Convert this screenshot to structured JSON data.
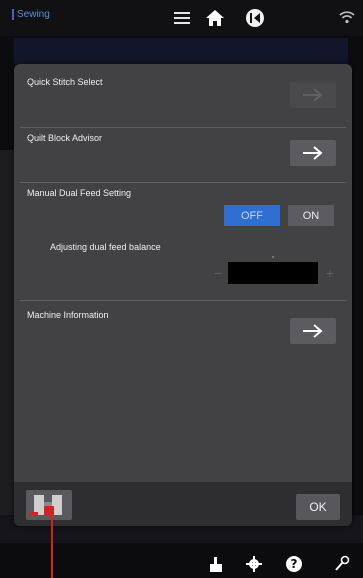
{
  "header": {
    "mode_label": "Sewing",
    "icons": [
      "menu-icon",
      "home-icon",
      "back-icon",
      "wifi-icon"
    ]
  },
  "dialog": {
    "quick_stitch_select": {
      "label": "Quick Stitch Select",
      "enabled": false
    },
    "quilt_block_advisor": {
      "label": "Quilt Block Advisor",
      "enabled": true
    },
    "manual_dual_feed": {
      "label": "Manual Dual Feed Setting",
      "off_label": "OFF",
      "on_label": "ON",
      "selected": "OFF",
      "balance_label": "Adjusting dual feed balance",
      "minus": "−",
      "plus": "+"
    },
    "machine_information": {
      "label": "Machine Information"
    },
    "ok_label": "OK"
  },
  "footer_icons": [
    "trash-icon",
    "settings-icon",
    "help-icon",
    "wrench-icon"
  ],
  "colors": {
    "accent": "#2f6fd1",
    "dialog_bg": "#424244",
    "button_bg": "#5b5b60",
    "pointer": "#d32222"
  }
}
